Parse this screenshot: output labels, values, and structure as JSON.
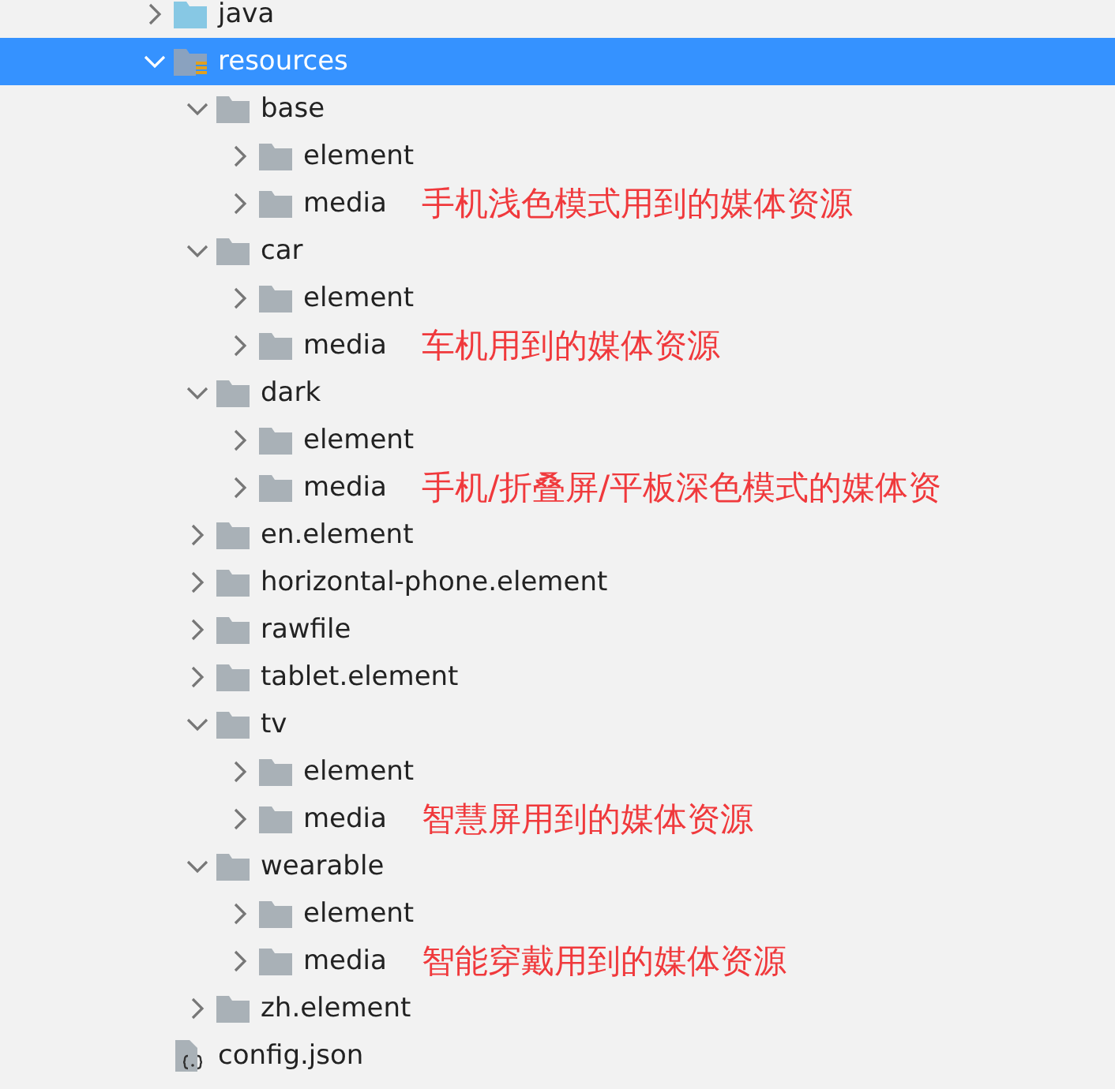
{
  "tree": [
    {
      "label": "java",
      "kind": "source-folder",
      "expanded": false,
      "selected": false
    },
    {
      "label": "resources",
      "kind": "resource-folder",
      "expanded": true,
      "selected": true,
      "children": [
        {
          "label": "base",
          "kind": "folder",
          "expanded": true,
          "selected": false,
          "children": [
            {
              "label": "element",
              "kind": "folder",
              "expanded": false,
              "selected": false
            },
            {
              "label": "media",
              "kind": "folder",
              "expanded": false,
              "selected": false,
              "note": "手机浅色模式用到的媒体资源"
            }
          ]
        },
        {
          "label": "car",
          "kind": "folder",
          "expanded": true,
          "selected": false,
          "children": [
            {
              "label": "element",
              "kind": "folder",
              "expanded": false,
              "selected": false
            },
            {
              "label": "media",
              "kind": "folder",
              "expanded": false,
              "selected": false,
              "note": "车机用到的媒体资源"
            }
          ]
        },
        {
          "label": "dark",
          "kind": "folder",
          "expanded": true,
          "selected": false,
          "children": [
            {
              "label": "element",
              "kind": "folder",
              "expanded": false,
              "selected": false
            },
            {
              "label": "media",
              "kind": "folder",
              "expanded": false,
              "selected": false,
              "note": "手机/折叠屏/平板深色模式的媒体资"
            }
          ]
        },
        {
          "label": "en.element",
          "kind": "folder",
          "expanded": false,
          "selected": false
        },
        {
          "label": "horizontal-phone.element",
          "kind": "folder",
          "expanded": false,
          "selected": false
        },
        {
          "label": "rawfile",
          "kind": "folder",
          "expanded": false,
          "selected": false
        },
        {
          "label": "tablet.element",
          "kind": "folder",
          "expanded": false,
          "selected": false
        },
        {
          "label": "tv",
          "kind": "folder",
          "expanded": true,
          "selected": false,
          "children": [
            {
              "label": "element",
              "kind": "folder",
              "expanded": false,
              "selected": false
            },
            {
              "label": "media",
              "kind": "folder",
              "expanded": false,
              "selected": false,
              "note": "智慧屏用到的媒体资源"
            }
          ]
        },
        {
          "label": "wearable",
          "kind": "folder",
          "expanded": true,
          "selected": false,
          "children": [
            {
              "label": "element",
              "kind": "folder",
              "expanded": false,
              "selected": false
            },
            {
              "label": "media",
              "kind": "folder",
              "expanded": false,
              "selected": false,
              "note": "智能穿戴用到的媒体资源"
            }
          ]
        },
        {
          "label": "zh.element",
          "kind": "folder",
          "expanded": false,
          "selected": false
        }
      ]
    },
    {
      "label": "config.json",
      "kind": "json-file",
      "selected": false
    }
  ]
}
